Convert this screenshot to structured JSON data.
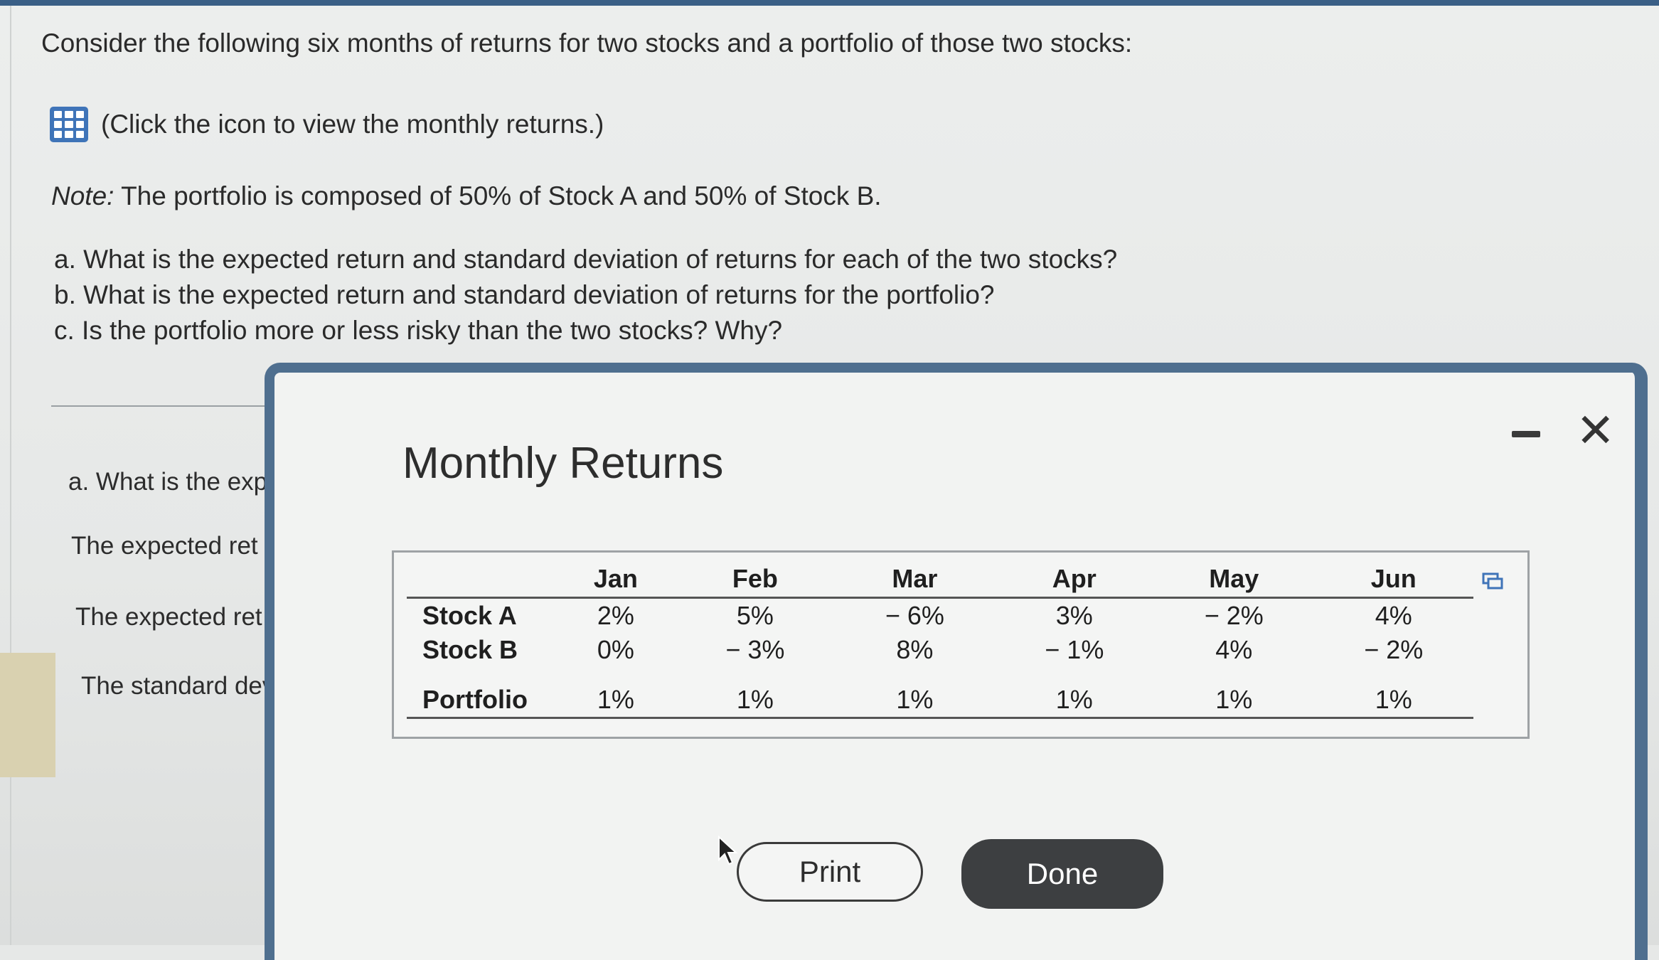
{
  "question": {
    "intro": "Consider the following six months of returns for two stocks and a portfolio of those two stocks:",
    "icon_link_text": "(Click the icon to view the monthly returns.)",
    "note_label": "Note:",
    "note_text": "The portfolio is composed of 50% of Stock A and 50% of Stock B.",
    "part_a": "a. What is the expected return and standard deviation of returns for each of the two stocks?",
    "part_b": "b. What is the expected return and standard deviation of returns for the portfolio?",
    "part_c": "c. Is the portfolio more or less risky than the two stocks? Why?"
  },
  "background_answers": {
    "line1": "a. What is the exp",
    "line2": "The expected ret",
    "line3": "The expected ret",
    "line4": "The standard dev"
  },
  "modal": {
    "title": "Monthly Returns",
    "print_label": "Print",
    "done_label": "Done"
  },
  "returns_table": {
    "months": [
      "Jan",
      "Feb",
      "Mar",
      "Apr",
      "May",
      "Jun"
    ],
    "rows": [
      {
        "label": "Stock A",
        "values": [
          "2%",
          "5%",
          "− 6%",
          "3%",
          "− 2%",
          "4%"
        ]
      },
      {
        "label": "Stock B",
        "values": [
          "0%",
          "− 3%",
          "8%",
          "− 1%",
          "4%",
          "− 2%"
        ]
      },
      {
        "label": "Portfolio",
        "values": [
          "1%",
          "1%",
          "1%",
          "1%",
          "1%",
          "1%"
        ]
      }
    ]
  },
  "icons": {
    "table_icon": "grid-table-icon",
    "minimize": "minimize-icon",
    "close": "close-icon",
    "copy": "copy-icon",
    "cursor": "mouse-pointer-icon"
  },
  "colors": {
    "accent_blue": "#3f74b8",
    "modal_border": "#4f6f8f",
    "done_button": "#3d3f41"
  }
}
